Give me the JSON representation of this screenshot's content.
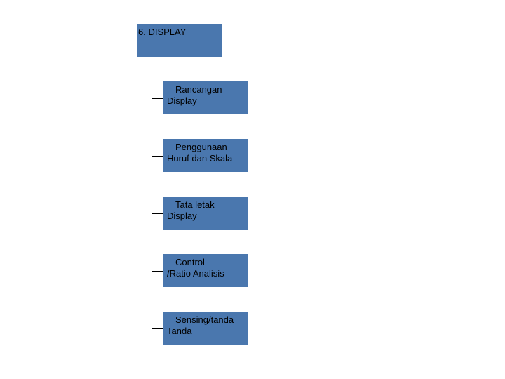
{
  "diagram": {
    "root": {
      "label": "6. DISPLAY"
    },
    "children": [
      {
        "line1": "Rancangan",
        "line2": "Display"
      },
      {
        "line1": "Penggunaan",
        "line2": "Huruf dan Skala"
      },
      {
        "line1": "Tata letak",
        "line2": "Display"
      },
      {
        "line1": "Control",
        "line2": "/Ratio Analisis"
      },
      {
        "line1": "Sensing/tanda",
        "line2": "Tanda"
      }
    ]
  },
  "colors": {
    "node_bg": "#4a77ae",
    "text": "#000000"
  }
}
